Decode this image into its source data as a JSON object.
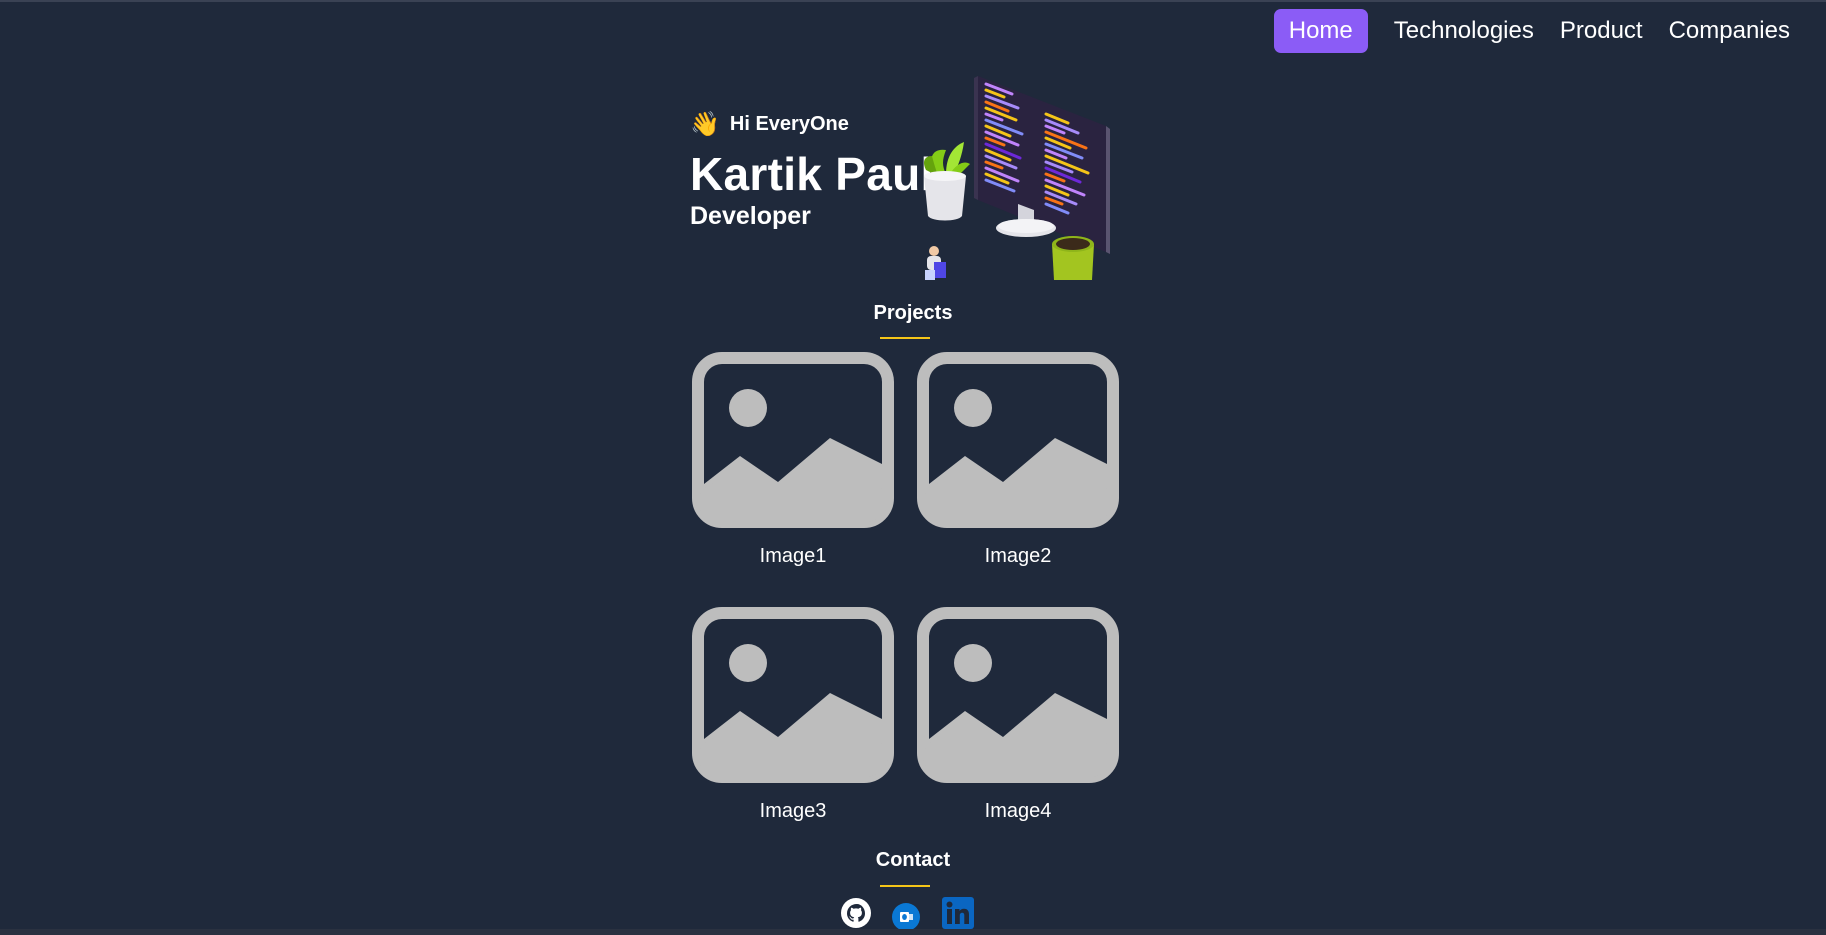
{
  "nav": {
    "items": [
      {
        "label": "Home",
        "active": true
      },
      {
        "label": "Technologies",
        "active": false
      },
      {
        "label": "Product",
        "active": false
      },
      {
        "label": "Companies",
        "active": false
      }
    ]
  },
  "hero": {
    "greeting": "Hi EveryOne",
    "wave_icon": "👋",
    "name": "Kartik Paul",
    "role": "Developer"
  },
  "projects": {
    "title": "Projects",
    "items": [
      {
        "label": "Image1",
        "icon": "image-placeholder-icon"
      },
      {
        "label": "Image2",
        "icon": "image-placeholder-icon"
      },
      {
        "label": "Image3",
        "icon": "image-placeholder-icon"
      },
      {
        "label": "Image4",
        "icon": "image-placeholder-icon"
      }
    ]
  },
  "contact": {
    "title": "Contact",
    "icons": [
      "github-icon",
      "outlook-icon",
      "linkedin-icon"
    ]
  },
  "colors": {
    "background": "#1f293b",
    "accent": "#8b5cf6",
    "underline": "#f5c518",
    "placeholder": "#bdbdbd"
  }
}
